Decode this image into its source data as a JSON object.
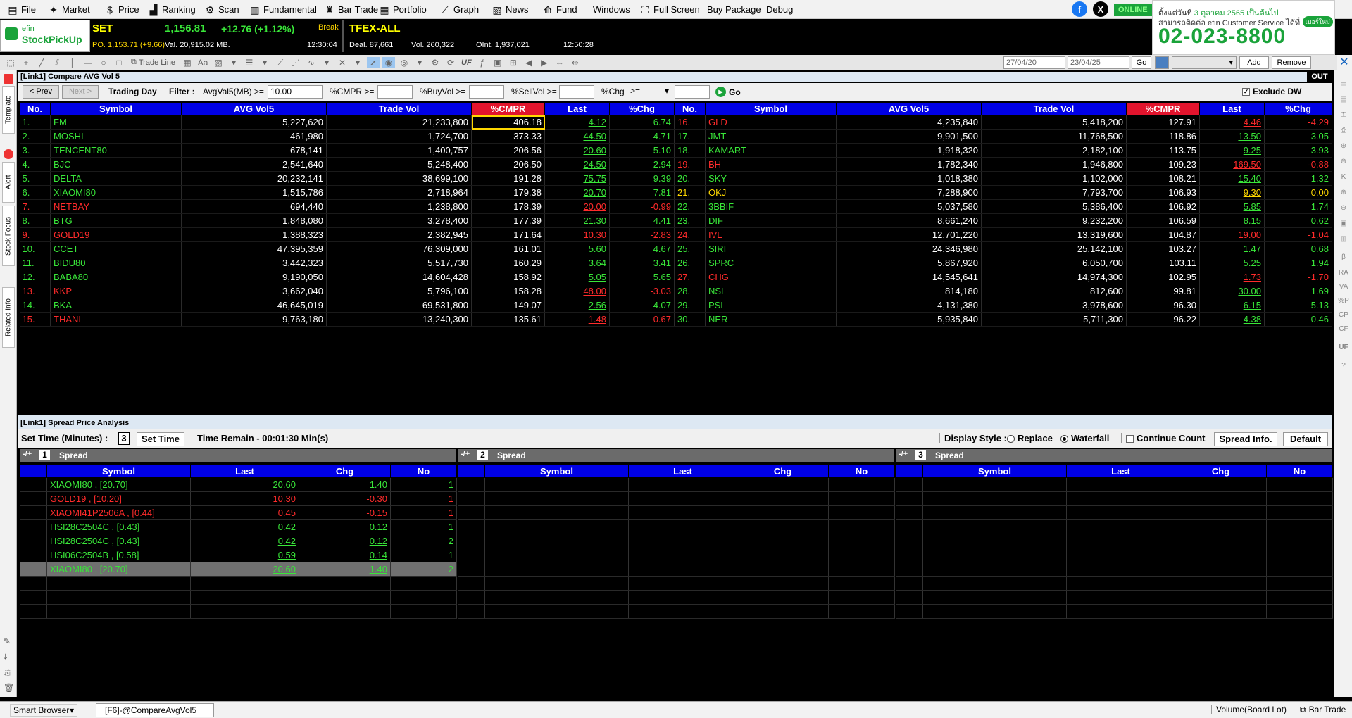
{
  "menu": [
    {
      "label": "File",
      "icon": "file-icon"
    },
    {
      "label": "Market",
      "icon": "market-icon"
    },
    {
      "label": "Price",
      "icon": "dollar-icon"
    },
    {
      "label": "Ranking",
      "icon": "ranking-icon"
    },
    {
      "label": "Scan",
      "icon": "scan-icon"
    },
    {
      "label": "Fundamental",
      "icon": "fundamental-icon"
    },
    {
      "label": "Bar Trade",
      "icon": "bar-trade-icon"
    },
    {
      "label": "Portfolio",
      "icon": "portfolio-icon"
    },
    {
      "label": "Graph",
      "icon": "graph-icon"
    },
    {
      "label": "News",
      "icon": "news-icon"
    },
    {
      "label": "Fund",
      "icon": "fund-icon"
    },
    {
      "label": "Windows",
      "icon": ""
    },
    {
      "label": "Full Screen",
      "icon": "full-screen-icon"
    },
    {
      "label": "Buy Package",
      "icon": ""
    },
    {
      "label": "Debug",
      "icon": ""
    }
  ],
  "status_online": "ONLINE",
  "banner": {
    "line1_pre": "ตั้งแต่วันที่",
    "line1_date": "3 ตุลาคม 2565 เป็นต้นไป",
    "line2": "สามารถติดต่อ efin Customer Service ได้ที่",
    "bubble": "เบอร์ใหม่",
    "phone": "02-023-8800"
  },
  "logo": {
    "top": "efin",
    "bottom": "StockPickUp"
  },
  "set": {
    "name": "SET",
    "index": "1,156.81",
    "change": "+12.76 (+1.12%)",
    "state": "Break",
    "po": "PO. 1,153.71 (+9.66)",
    "val": "Val. 20,915.02 MB.",
    "time": "12:30:04"
  },
  "tfex": {
    "name": "TFEX-ALL",
    "deal": "Deal. 87,661",
    "vol": "Vol. 260,322",
    "oint": "OInt. 1,937,021",
    "time": "12:50:28"
  },
  "toolbar": {
    "trade_line": "Trade Line",
    "uf": "UF",
    "date_from": "27/04/20",
    "date_to": "23/04/25",
    "go": "Go",
    "add": "Add",
    "remove": "Remove"
  },
  "left_tabs": [
    "Template",
    "Alert",
    "Stock Focus",
    "Related Info"
  ],
  "right_tools": [
    "RA",
    "VA",
    "%P",
    "CP",
    "CF",
    "UF"
  ],
  "panel1": {
    "title": "[Link1] Compare AVG Vol 5",
    "out": "OUT",
    "prev": "< Prev",
    "next": "Next >",
    "trading_day": "Trading Day",
    "filter": "Filter :",
    "f1_label": "AvgVal5(MB) >=",
    "f1_value": "10.00",
    "f2_label": "%CMPR >=",
    "f3_label": "%BuyVol >=",
    "f4_label": "%SellVol >=",
    "f5_label": "%Chg",
    "f5_op": ">=",
    "go": "Go",
    "exclude": "Exclude DW",
    "check": "✓"
  },
  "cols": [
    "No.",
    "Symbol",
    "AVG Vol5",
    "Trade Vol",
    "%CMPR",
    "Last",
    "%Chg"
  ],
  "left_rows": [
    [
      "1.",
      "FM",
      "5,227,620",
      "21,233,800",
      "406.18",
      "4.12",
      "6.74",
      "g"
    ],
    [
      "2.",
      "MOSHI",
      "461,980",
      "1,724,700",
      "373.33",
      "44.50",
      "4.71",
      "g"
    ],
    [
      "3.",
      "TENCENT80",
      "678,141",
      "1,400,757",
      "206.56",
      "20.60",
      "5.10",
      "g"
    ],
    [
      "4.",
      "BJC",
      "2,541,640",
      "5,248,400",
      "206.50",
      "24.50",
      "2.94",
      "g"
    ],
    [
      "5.",
      "DELTA",
      "20,232,141",
      "38,699,100",
      "191.28",
      "75.75",
      "9.39",
      "g"
    ],
    [
      "6.",
      "XIAOMI80",
      "1,515,786",
      "2,718,964",
      "179.38",
      "20.70",
      "7.81",
      "g"
    ],
    [
      "7.",
      "NETBAY",
      "694,440",
      "1,238,800",
      "178.39",
      "20.00",
      "-0.99",
      "r"
    ],
    [
      "8.",
      "BTG",
      "1,848,080",
      "3,278,400",
      "177.39",
      "21.30",
      "4.41",
      "g"
    ],
    [
      "9.",
      "GOLD19",
      "1,388,323",
      "2,382,945",
      "171.64",
      "10.30",
      "-2.83",
      "r"
    ],
    [
      "10.",
      "CCET",
      "47,395,359",
      "76,309,000",
      "161.01",
      "5.60",
      "4.67",
      "g"
    ],
    [
      "11.",
      "BIDU80",
      "3,442,323",
      "5,517,730",
      "160.29",
      "3.64",
      "3.41",
      "g"
    ],
    [
      "12.",
      "BABA80",
      "9,190,050",
      "14,604,428",
      "158.92",
      "5.05",
      "5.65",
      "g"
    ],
    [
      "13.",
      "KKP",
      "3,662,040",
      "5,796,100",
      "158.28",
      "48.00",
      "-3.03",
      "r"
    ],
    [
      "14.",
      "BKA",
      "46,645,019",
      "69,531,800",
      "149.07",
      "2.56",
      "4.07",
      "g"
    ],
    [
      "15.",
      "THANI",
      "9,763,180",
      "13,240,300",
      "135.61",
      "1.48",
      "-0.67",
      "r"
    ]
  ],
  "right_rows": [
    [
      "16.",
      "GLD",
      "4,235,840",
      "5,418,200",
      "127.91",
      "4.46",
      "-4.29",
      "r"
    ],
    [
      "17.",
      "JMT",
      "9,901,500",
      "11,768,500",
      "118.86",
      "13.50",
      "3.05",
      "g"
    ],
    [
      "18.",
      "KAMART",
      "1,918,320",
      "2,182,100",
      "113.75",
      "9.25",
      "3.93",
      "g"
    ],
    [
      "19.",
      "BH",
      "1,782,340",
      "1,946,800",
      "109.23",
      "169.50",
      "-0.88",
      "r"
    ],
    [
      "20.",
      "SKY",
      "1,018,380",
      "1,102,000",
      "108.21",
      "15.40",
      "1.32",
      "g"
    ],
    [
      "21.",
      "OKJ",
      "7,288,900",
      "7,793,700",
      "106.93",
      "9.30",
      "0.00",
      "y"
    ],
    [
      "22.",
      "3BBIF",
      "5,037,580",
      "5,386,400",
      "106.92",
      "5.85",
      "1.74",
      "g"
    ],
    [
      "23.",
      "DIF",
      "8,661,240",
      "9,232,200",
      "106.59",
      "8.15",
      "0.62",
      "g"
    ],
    [
      "24.",
      "IVL",
      "12,701,220",
      "13,319,600",
      "104.87",
      "19.00",
      "-1.04",
      "r"
    ],
    [
      "25.",
      "SIRI",
      "24,346,980",
      "25,142,100",
      "103.27",
      "1.47",
      "0.68",
      "g"
    ],
    [
      "26.",
      "SPRC",
      "5,867,920",
      "6,050,700",
      "103.11",
      "5.25",
      "1.94",
      "g"
    ],
    [
      "27.",
      "CHG",
      "14,545,641",
      "14,974,300",
      "102.95",
      "1.73",
      "-1.70",
      "r"
    ],
    [
      "28.",
      "NSL",
      "814,180",
      "812,600",
      "99.81",
      "30.00",
      "1.69",
      "g"
    ],
    [
      "29.",
      "PSL",
      "4,131,380",
      "3,978,600",
      "96.30",
      "6.15",
      "5.13",
      "g"
    ],
    [
      "30.",
      "NER",
      "5,935,840",
      "5,711,300",
      "96.22",
      "4.38",
      "0.46",
      "g"
    ]
  ],
  "panel2": {
    "title": "[Link1] Spread Price Analysis",
    "set_time_label": "Set Time (Minutes) :",
    "set_time_value": "3",
    "set_time_btn": "Set Time",
    "time_remain": "Time Remain - 00:01:30 Min(s)",
    "display_style": "Display Style :",
    "replace": "Replace",
    "waterfall": "Waterfall",
    "continue_count": "Continue Count",
    "spread_info": "Spread Info.",
    "default": "Default"
  },
  "spread_cols": [
    "Symbol",
    "Last",
    "Chg",
    "No"
  ],
  "spreads": [
    {
      "pm": "-/+",
      "num": "1",
      "label": "Spread"
    },
    {
      "pm": "-/+",
      "num": "2",
      "label": "Spread"
    },
    {
      "pm": "-/+",
      "num": "3",
      "label": "Spread"
    }
  ],
  "spread1_rows": [
    [
      "XIAOMI80 , [20.70]",
      "20.60",
      "1.40",
      "1",
      "g"
    ],
    [
      "GOLD19 , [10.20]",
      "10.30",
      "-0.30",
      "1",
      "r"
    ],
    [
      "XIAOMI41P2506A , [0.44]",
      "0.45",
      "-0.15",
      "1",
      "r"
    ],
    [
      "HSI28C2504C , [0.43]",
      "0.42",
      "0.12",
      "1",
      "g"
    ],
    [
      "HSI28C2504C , [0.43]",
      "0.42",
      "0.12",
      "2",
      "g"
    ],
    [
      "HSI06C2504B , [0.58]",
      "0.59",
      "0.14",
      "1",
      "g"
    ],
    [
      "XIAOMI80 , [20.70]",
      "20.60",
      "1.40",
      "2",
      "g"
    ]
  ],
  "statusbar": {
    "smart_browser": "Smart Browser",
    "tab": "[F6]-@CompareAvgVol5",
    "volume": "Volume(Board Lot)",
    "bar_trade": "Bar Trade"
  },
  "colors": {
    "green": "#39e639",
    "red": "#ff2b2b",
    "yellow": "#ffd800",
    "header_blue": "#0000e6",
    "header_red": "#e2142d"
  }
}
